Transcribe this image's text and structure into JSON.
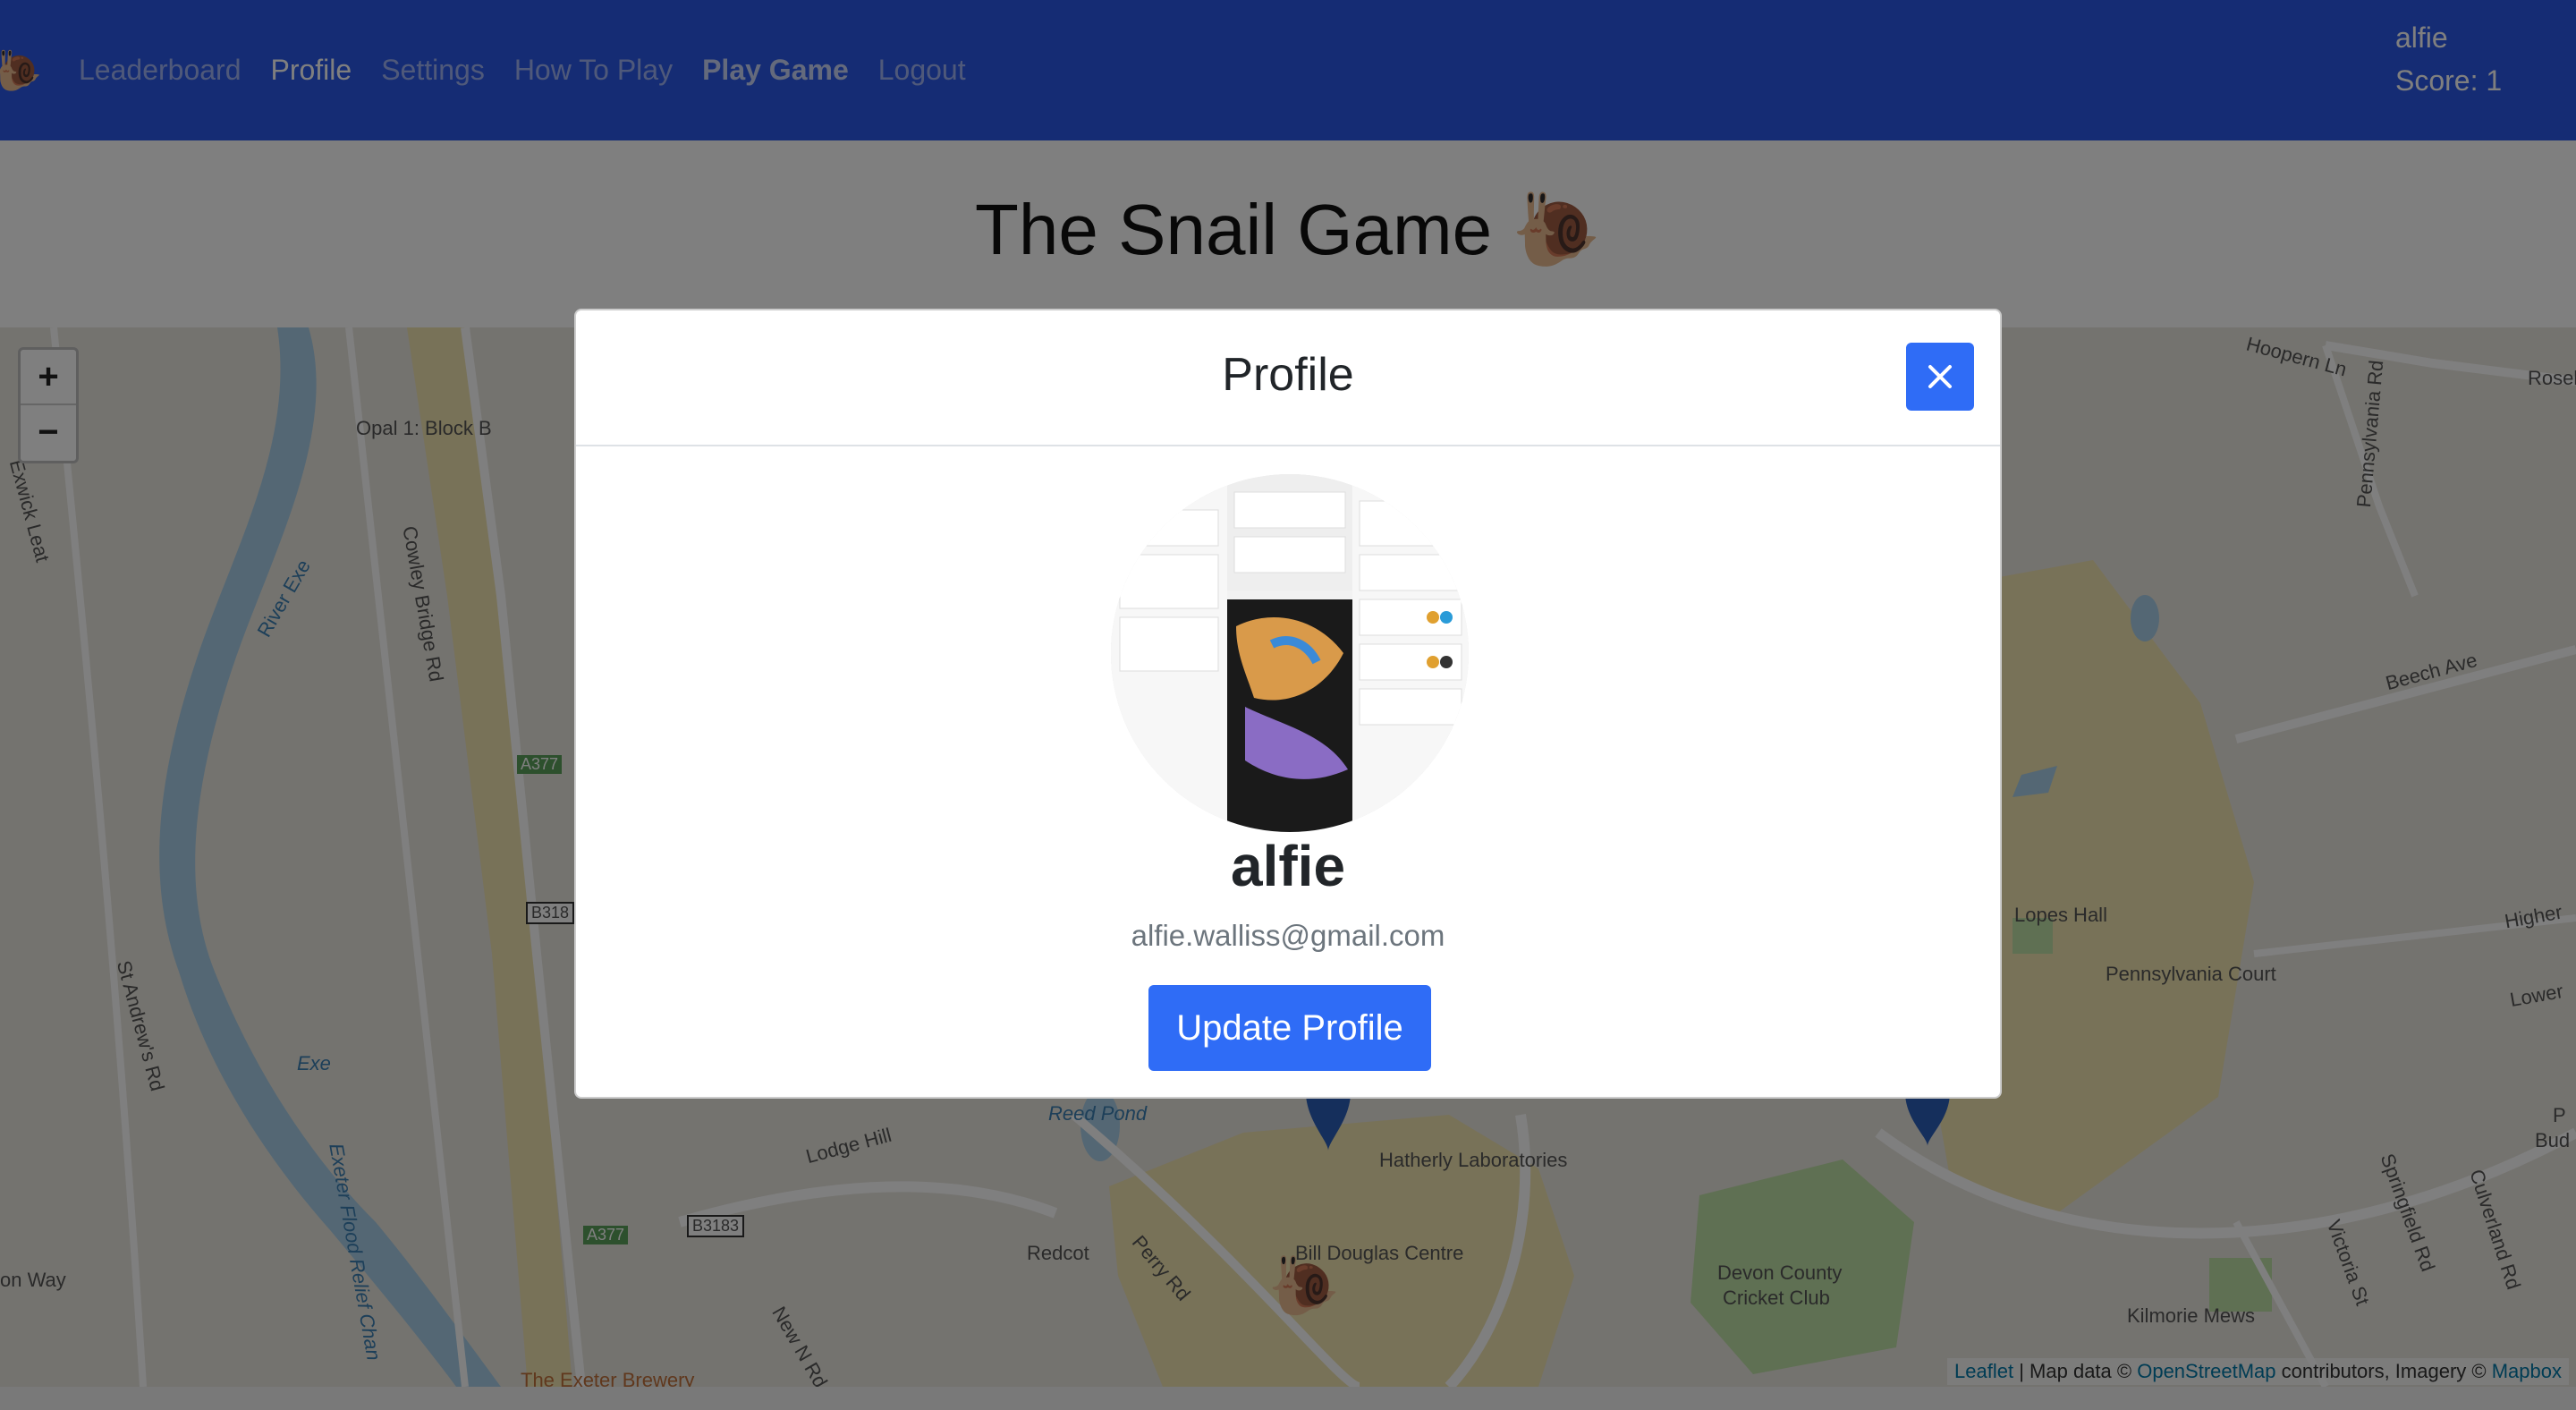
{
  "navbar": {
    "brand_icon": "🐌",
    "links": [
      "Leaderboard",
      "Profile",
      "Settings",
      "How To Play",
      "Play Game",
      "Logout"
    ],
    "username": "alfie",
    "score": "Score: 1"
  },
  "page": {
    "title": "The Snail Game 🐌"
  },
  "map": {
    "labels": {
      "opal": "Opal 1: Block B",
      "cowley": "Cowley Bridge Rd",
      "river_exe": "River Exe",
      "exwick": "Exwick Leat",
      "a377_1": "A377",
      "b318": "B318",
      "st_andrews": "St Andrew's Rd",
      "exe": "Exe",
      "flood": "Exeter Flood Relief Chan",
      "lodge": "Lodge Hill",
      "b3183": "B3183",
      "a377_2": "A377",
      "redcot": "Redcot",
      "perry": "Perry Rd",
      "reed_pond": "Reed Pond",
      "hatherly": "Hatherly Laboratories",
      "bill_douglas": "Bill Douglas Centre",
      "new_n_rd": "New N Rd",
      "brewery": "The Exeter Brewery",
      "on_way": "on Way",
      "hoopern": "Hoopern Ln",
      "pennsylvania_rd": "Pennsylvania Rd",
      "rosel": "Rosel",
      "beech": "Beech Ave",
      "lopes": "Lopes Hall",
      "penn_court": "Pennsylvania Court",
      "higher": "Higher",
      "lower": "Lower",
      "devon": "Devon County",
      "cricket": "Cricket Club",
      "kilmorie": "Kilmorie Mews",
      "springfield": "Springfield Rd",
      "victoria": "Victoria St",
      "culverland": "Culverland Rd",
      "pbud_p": "P",
      "pbud_bud": "Bud"
    },
    "zoom_in": "+",
    "zoom_out": "−",
    "attribution": {
      "leaflet": "Leaflet",
      "text1": " | Map data © ",
      "osm": "OpenStreetMap",
      "text2": " contributors, Imagery © ",
      "mapbox": "Mapbox"
    }
  },
  "modal": {
    "title": "Profile",
    "name": "alfie",
    "email": "alfie.walliss@gmail.com",
    "button": "Update Profile"
  },
  "colors": {
    "navbar": "#2b58e8",
    "primary": "#2f6cf6"
  }
}
